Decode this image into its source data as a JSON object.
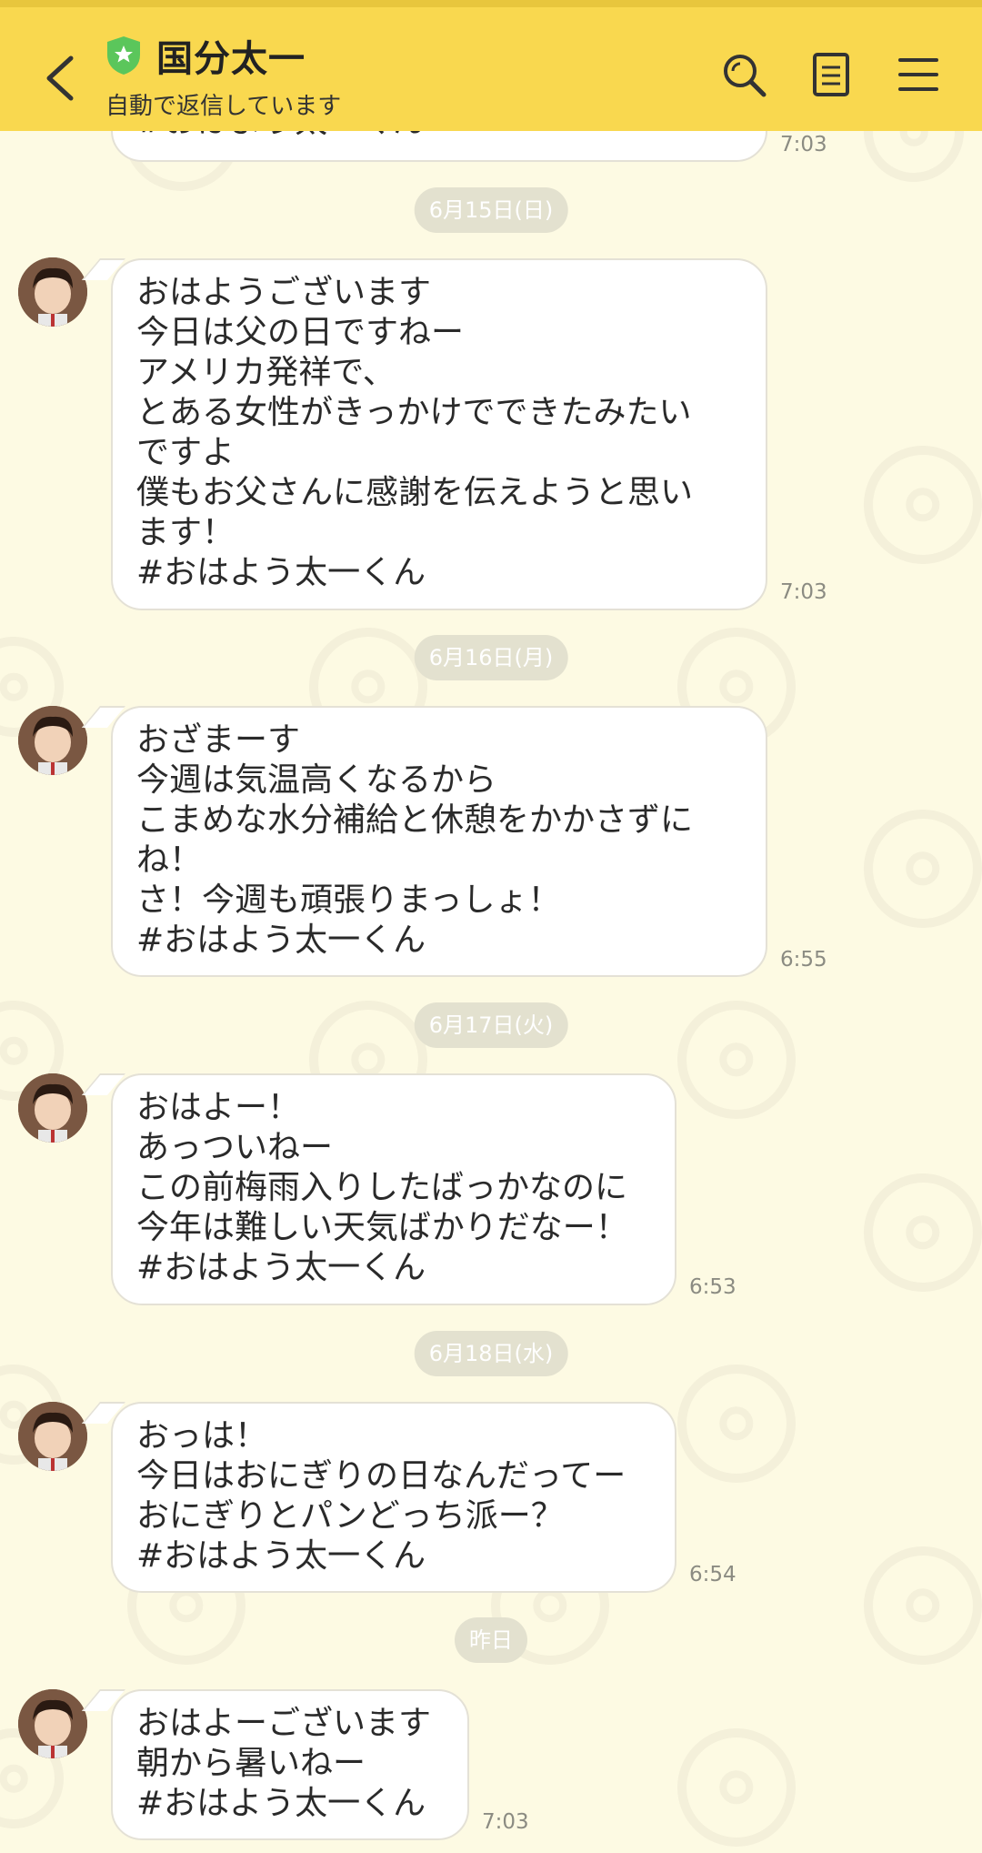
{
  "header": {
    "title": "国分太一",
    "subtitle": "自動で返信しています"
  },
  "messages": [
    {
      "date": "",
      "text": "#おはよう太一くん",
      "time": "7:03"
    },
    {
      "date": "6月15日(日)",
      "text": "おはようございます\n今日は父の日ですねー\nアメリカ発祥で、\nとある女性がきっかけでできたみたい\nですよ\n僕もお父さんに感謝を伝えようと思い\nます！\n#おはよう太一くん",
      "time": "7:03"
    },
    {
      "date": "6月16日(月)",
      "text": "おざまーす\n今週は気温高くなるから\nこまめな水分補給と休憩をかかさずに\nね！\nさ！今週も頑張りまっしょ！\n#おはよう太一くん",
      "time": "6:55"
    },
    {
      "date": "6月17日(火)",
      "text": "おはよー！\nあっついねー\nこの前梅雨入りしたばっかなのに\n今年は難しい天気ばかりだなー！\n#おはよう太一くん",
      "time": "6:53"
    },
    {
      "date": "6月18日(水)",
      "text": "おっは！\n今日はおにぎりの日なんだってー\nおにぎりとパンどっち派ー？\n#おはよう太一くん",
      "time": "6:54"
    },
    {
      "date": "昨日",
      "text": "おはよーございます\n朝から暑いねー\n#おはよう太一くん",
      "time": "7:03"
    }
  ],
  "colors": {
    "header_bg": "#F9D84F",
    "chat_bg": "#FDFAE3",
    "badge": "#5BC65B"
  }
}
